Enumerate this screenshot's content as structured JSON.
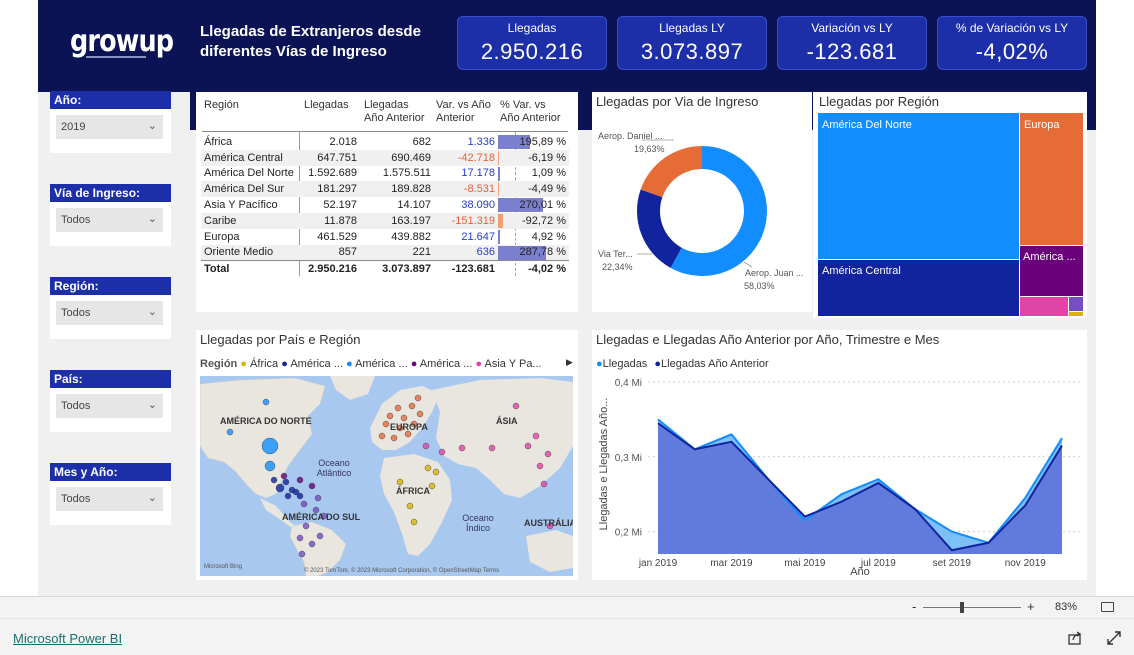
{
  "brand": {
    "logo": "growup"
  },
  "header": {
    "title": "Llegadas de Extranjeros desde diferentes Vías de Ingreso"
  },
  "kpis": [
    {
      "label": "Llegadas",
      "value": "2.950.216"
    },
    {
      "label": "Llegadas LY",
      "value": "3.073.897"
    },
    {
      "label": "Variación vs LY",
      "value": "-123.681"
    },
    {
      "label": "% de Variación vs LY",
      "value": "-4,02%"
    }
  ],
  "slicers": [
    {
      "label": "Año:",
      "value": "2019"
    },
    {
      "label": "Vía de Ingreso:",
      "value": "Todos"
    },
    {
      "label": "Región:",
      "value": "Todos"
    },
    {
      "label": "País:",
      "value": "Todos"
    },
    {
      "label": "Mes y Año:",
      "value": "Todos"
    }
  ],
  "table": {
    "headers": [
      "Región",
      "Llegadas",
      "Llegadas Año Anterior",
      "Var. vs Año Anterior",
      "% Var. vs Año Anterior"
    ],
    "rows": [
      {
        "region": "África",
        "llegadas": "2.018",
        "ly": "682",
        "var": "1.336",
        "pct": "195,89 %",
        "pct_num": 195.89
      },
      {
        "region": "América Central",
        "llegadas": "647.751",
        "ly": "690.469",
        "var": "-42.718",
        "pct": "-6,19 %",
        "pct_num": -6.19
      },
      {
        "region": "América Del Norte",
        "llegadas": "1.592.689",
        "ly": "1.575.511",
        "var": "17.178",
        "pct": "1,09 %",
        "pct_num": 1.09
      },
      {
        "region": "América Del Sur",
        "llegadas": "181.297",
        "ly": "189.828",
        "var": "-8.531",
        "pct": "-4,49 %",
        "pct_num": -4.49
      },
      {
        "region": "Asia Y Pacífico",
        "llegadas": "52.197",
        "ly": "14.107",
        "var": "38.090",
        "pct": "270,01 %",
        "pct_num": 270.01
      },
      {
        "region": "Caribe",
        "llegadas": "11.878",
        "ly": "163.197",
        "var": "-151.319",
        "pct": "-92,72 %",
        "pct_num": -92.72
      },
      {
        "region": "Europa",
        "llegadas": "461.529",
        "ly": "439.882",
        "var": "21.647",
        "pct": "4,92 %",
        "pct_num": 4.92
      },
      {
        "region": "Oriente Medio",
        "llegadas": "857",
        "ly": "221",
        "var": "636",
        "pct": "287,78 %",
        "pct_num": 287.78
      }
    ],
    "total": {
      "region": "Total",
      "llegadas": "2.950.216",
      "ly": "3.073.897",
      "var": "-123.681",
      "pct": "-4,02 %"
    }
  },
  "donut": {
    "title": "Llegadas por Via de Ingreso",
    "slices": [
      {
        "label": "Aerop. Juan ...",
        "pct_label": "58,03%",
        "value": 58.03,
        "color": "#118dff"
      },
      {
        "label": "Via Ter...",
        "pct_label": "22,34%",
        "value": 22.34,
        "color": "#12239e"
      },
      {
        "label": "Aerop. Daniel ...",
        "pct_label": "19,63%",
        "value": 19.63,
        "color": "#e66c37"
      }
    ]
  },
  "treemap": {
    "title": "Llegadas por Región",
    "labels": [
      "América Del Norte",
      "Europa",
      "América Central",
      "América ..."
    ],
    "colors": {
      "norte": "#118dff",
      "europa": "#e66c37",
      "central": "#12239e",
      "sur": "#6b007b",
      "asia": "#e044a7",
      "medio": "#744ec2",
      "africa": "#d9b300"
    }
  },
  "map": {
    "title": "Llegadas por País e Región",
    "legend_title": "Región",
    "legend": [
      {
        "label": "África",
        "color": "#d9b300"
      },
      {
        "label": "América ...",
        "color": "#12239e"
      },
      {
        "label": "América ...",
        "color": "#118dff"
      },
      {
        "label": "América ...",
        "color": "#6b007b"
      },
      {
        "label": "Asia Y Pa...",
        "color": "#e044a7"
      }
    ],
    "place_labels": [
      "AMÉRICA DO NORTE",
      "EUROPA",
      "ÁSIA",
      "Oceano Atlântico",
      "ÁFRICA",
      "AMÉRICA DO SUL",
      "Oceano Índico",
      "AUSTRÁLIA"
    ],
    "attribution": "© 2023 TomTom, © 2023 Microsoft Corporation, © OpenStreetMap  Terms",
    "bing": "Microsoft Bing"
  },
  "line_chart": {
    "title": "Llegadas e Llegadas Año Anterior por Año, Trimestre e Mes",
    "legend": [
      {
        "label": "Llegadas",
        "color": "#118dff"
      },
      {
        "label": "Llegadas Año Anterior",
        "color": "#12239e"
      }
    ]
  },
  "chart_data": {
    "type": "area",
    "title": "Llegadas e Llegadas Año Anterior por Año, Trimestre e Mes",
    "xlabel": "Año",
    "ylabel": "Llegadas e Llegadas Año...",
    "x": [
      "ene 2019",
      "feb 2019",
      "mar 2019",
      "abr 2019",
      "may 2019",
      "jun 2019",
      "jul 2019",
      "ago 2019",
      "sep 2019",
      "oct 2019",
      "nov 2019",
      "dic 2019"
    ],
    "x_tick_labels": [
      "jan 2019",
      "mar 2019",
      "mai 2019",
      "jul 2019",
      "set 2019",
      "nov 2019"
    ],
    "y_tick_labels": [
      "0,2 Mi",
      "0,3 Mi",
      "0,4 Mi"
    ],
    "ylim": [
      0.17,
      0.4
    ],
    "y_unit": "Mi",
    "series": [
      {
        "name": "Llegadas",
        "values": [
          0.35,
          0.31,
          0.33,
          0.27,
          0.215,
          0.25,
          0.27,
          0.23,
          0.2,
          0.185,
          0.245,
          0.325
        ]
      },
      {
        "name": "Llegadas Año Anterior",
        "values": [
          0.345,
          0.31,
          0.32,
          0.27,
          0.22,
          0.24,
          0.265,
          0.23,
          0.175,
          0.185,
          0.235,
          0.315
        ]
      }
    ]
  },
  "zoom": {
    "value": "83%",
    "minus": "-",
    "plus": "+"
  },
  "footer": {
    "powerbi_link": "Microsoft Power BI"
  }
}
